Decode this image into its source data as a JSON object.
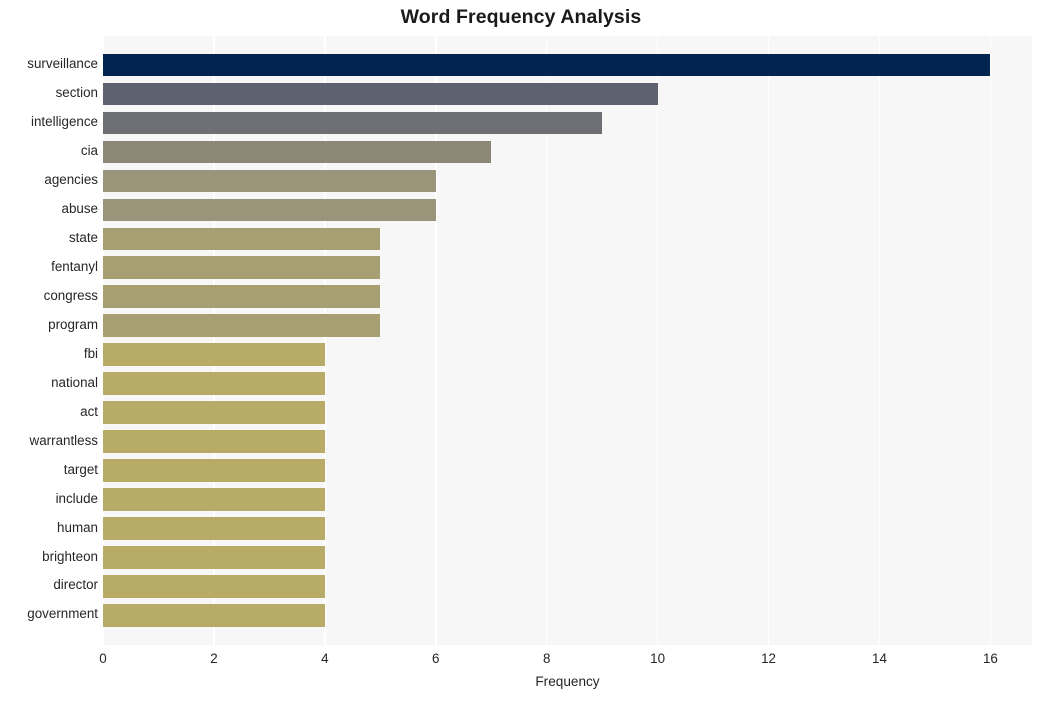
{
  "chart_data": {
    "type": "bar",
    "orientation": "horizontal",
    "title": "Word Frequency Analysis",
    "xlabel": "Frequency",
    "ylabel": "",
    "categories": [
      "surveillance",
      "section",
      "intelligence",
      "cia",
      "agencies",
      "abuse",
      "state",
      "fentanyl",
      "congress",
      "program",
      "fbi",
      "national",
      "act",
      "warrantless",
      "target",
      "include",
      "human",
      "brighteon",
      "director",
      "government"
    ],
    "values": [
      16,
      10,
      9,
      7,
      6,
      6,
      5,
      5,
      5,
      5,
      4,
      4,
      4,
      4,
      4,
      4,
      4,
      4,
      4,
      4
    ],
    "bar_colors": [
      "#022450",
      "#5d6170",
      "#6d6f74",
      "#8b8878",
      "#99947a",
      "#99947a",
      "#a79f71",
      "#a79f71",
      "#a79f71",
      "#a79f71",
      "#b8ab68",
      "#b8ab68",
      "#b8ab68",
      "#b8ab68",
      "#b8ab68",
      "#b8ab68",
      "#b8ab68",
      "#b8ab68",
      "#b8ab68",
      "#b8ab68"
    ],
    "xlim": [
      0,
      16.75
    ],
    "xticks": [
      0,
      2,
      4,
      6,
      8,
      10,
      12,
      14,
      16
    ],
    "xtick_labels": [
      "0",
      "2",
      "4",
      "6",
      "8",
      "10",
      "12",
      "14",
      "16"
    ],
    "grid": {
      "vertical": true,
      "horizontal": false,
      "color": "#ffffff"
    },
    "legend": null,
    "plot_background": "#f7f7f7",
    "figure_background": "#ffffff",
    "title_color": "#1a1a1a",
    "tick_label_color": "#262626"
  }
}
